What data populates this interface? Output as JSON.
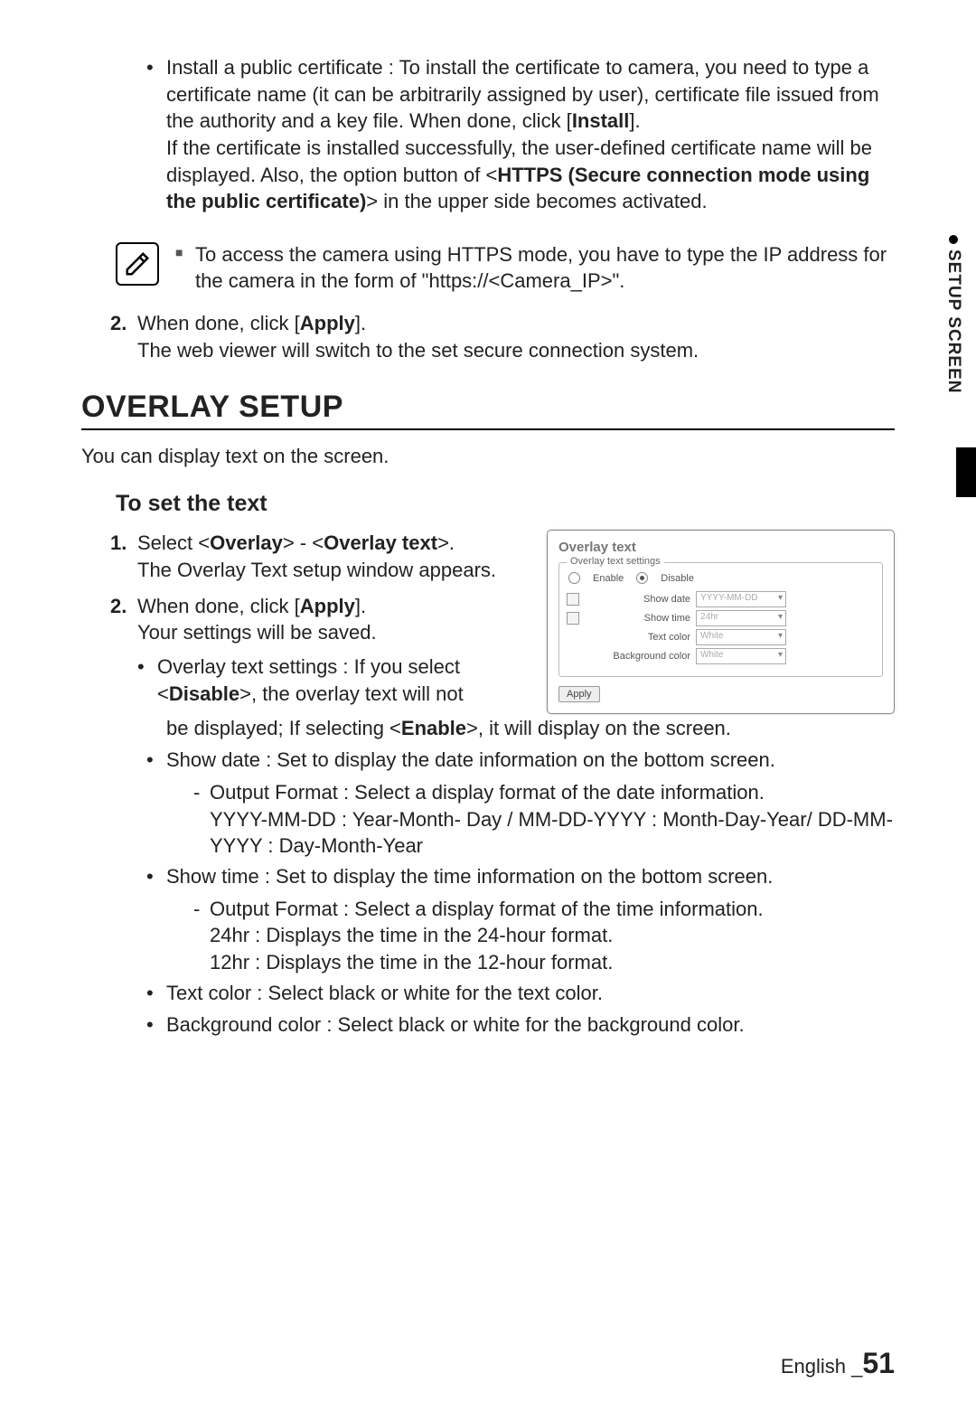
{
  "sideTab": "SETUP SCREEN",
  "top": {
    "bullet_prefix": "Install a public certificate : To install the certificate to camera, you need to type a certificate name (it can be arbitrarily assigned by user), certificate file issued from the authority and a key file. When done, click [",
    "bullet_bold1": "Install",
    "bullet_mid": "].\nIf the certificate is installed successfully, the user-defined certificate name will be displayed. Also, the option button of <",
    "bullet_bold2": "HTTPS (Secure connection mode using the public certificate)",
    "bullet_suffix": "> in the upper side becomes activated."
  },
  "note": "To access the camera using HTTPS mode, you have to type the IP address for the camera in the form of \"https://<Camera_IP>\".",
  "step2_top": {
    "a": "When done, click [",
    "bold": "Apply",
    "b": "].\nThe web viewer will switch to the set secure connection system."
  },
  "section": "OVERLAY SETUP",
  "intro": "You can display text on the screen.",
  "sub": "To set the text",
  "s1": {
    "a": "Select <",
    "b1": "Overlay",
    "b": "> - <",
    "b2": "Overlay text",
    "c": ">.\nThe Overlay Text setup window appears."
  },
  "s2": {
    "a": "When done, click [",
    "bold": "Apply",
    "b": "].\nYour settings will be saved."
  },
  "bl": {
    "ots_a": "Overlay text settings : If you select <",
    "ots_b1": "Disable",
    "ots_b": ">, the overlay text will not be displayed; If selecting <",
    "ots_b2": "Enable",
    "ots_c": ">, it will display on the screen.",
    "showdate": "Show date : Set to display the date information on the bottom screen.",
    "sd_of": "Output Format : Select a display format of the date information.\nYYYY-MM-DD : Year-Month- Day / MM-DD-YYYY : Month-Day-Year/ DD-MM-YYYY : Day-Month-Year",
    "showtime": "Show time : Set to display the time information on the bottom screen.",
    "st_of": "Output Format : Select a display format of the time information.\n24hr : Displays the time in the 24-hour format.\n12hr : Displays the time in the 12-hour format.",
    "textcolor": "Text color : Select black or white for the text color.",
    "bgcolor": "Background color : Select black or white for the background color."
  },
  "panel": {
    "title": "Overlay text",
    "legend": "Overlay text settings",
    "enable": "Enable",
    "disable": "Disable",
    "rows": {
      "showdate_lbl": "Show date",
      "showdate_val": "YYYY-MM-DD",
      "showtime_lbl": "Show time",
      "showtime_val": "24hr",
      "textcolor_lbl": "Text color",
      "textcolor_val": "White",
      "bgcolor_lbl": "Background color",
      "bgcolor_val": "White"
    },
    "apply": "Apply"
  },
  "footer": {
    "lang": "English",
    "sep": "_",
    "page": "51"
  }
}
